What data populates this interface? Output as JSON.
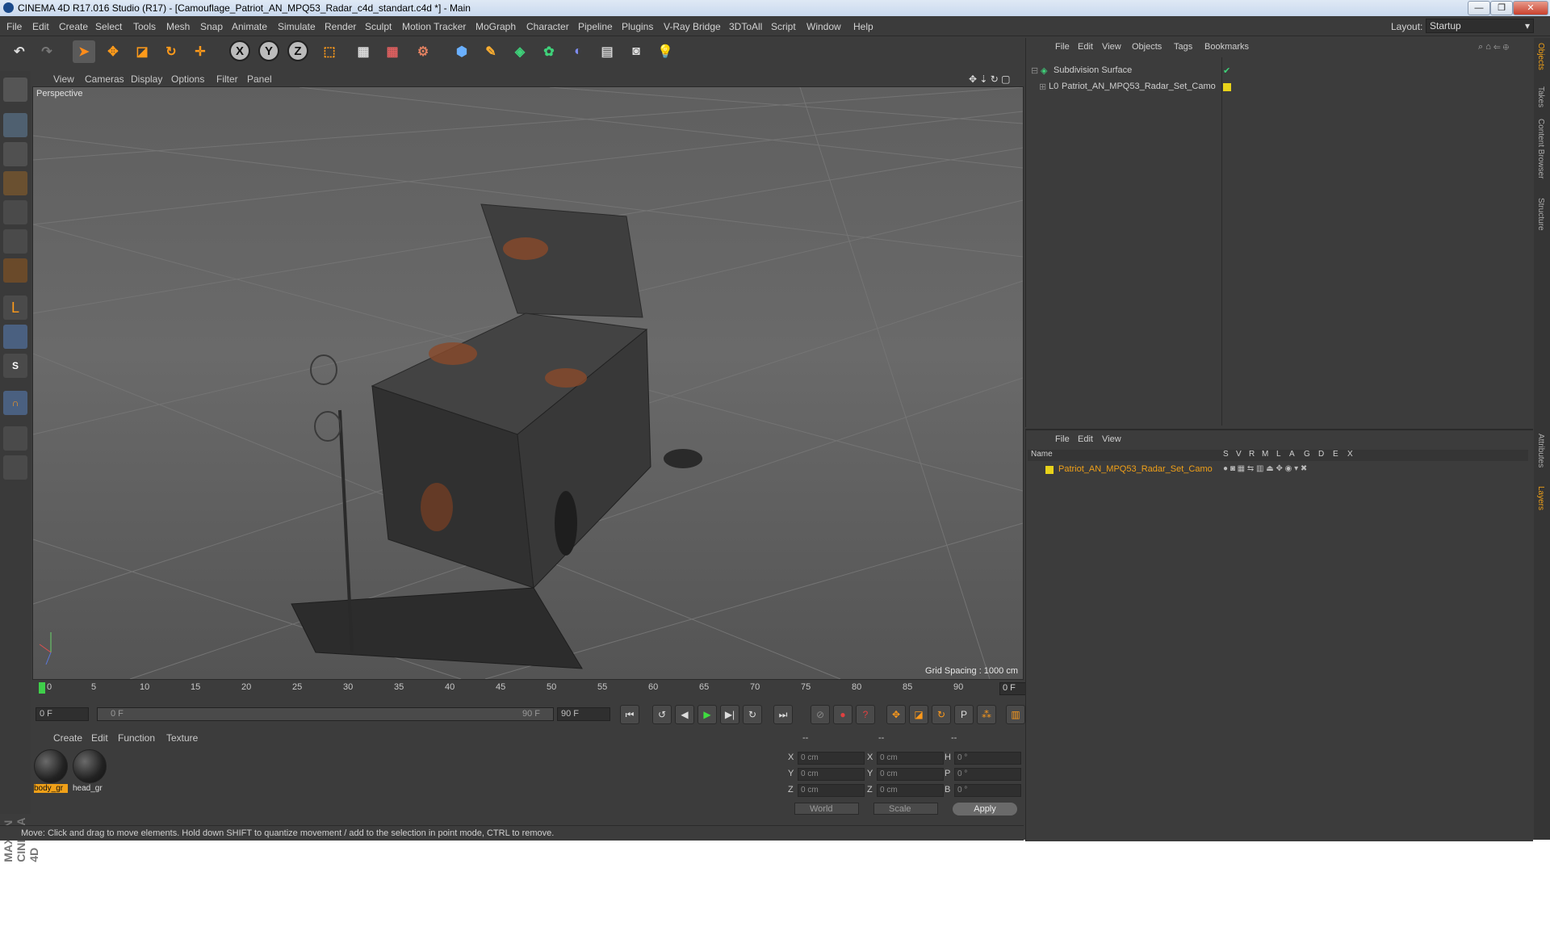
{
  "window": {
    "title": "CINEMA 4D R17.016 Studio (R17) - [Camouflage_Patriot_AN_MPQ53_Radar_c4d_standart.c4d *] - Main",
    "buttons": [
      "—",
      "❐",
      "✕"
    ]
  },
  "menubar": {
    "items": [
      "File",
      "Edit",
      "Create",
      "Select",
      "Tools",
      "Mesh",
      "Snap",
      "Animate",
      "Simulate",
      "Render",
      "Sculpt",
      "Motion Tracker",
      "MoGraph",
      "Character",
      "Pipeline",
      "Plugins",
      "V-Ray Bridge",
      "3DToAll",
      "Script",
      "Window",
      "Help"
    ],
    "layout_label": "Layout:",
    "layout_value": "Startup"
  },
  "toolbar": {
    "axis_x": "X",
    "axis_y": "Y",
    "axis_z": "Z"
  },
  "viewport": {
    "menu": [
      "View",
      "Cameras",
      "Display",
      "Options",
      "Filter",
      "Panel"
    ],
    "camera": "Perspective",
    "grid_spacing": "Grid Spacing : 1000 cm"
  },
  "timeline": {
    "ticks": [
      "0",
      "5",
      "10",
      "15",
      "20",
      "25",
      "30",
      "35",
      "40",
      "45",
      "50",
      "55",
      "60",
      "65",
      "70",
      "75",
      "80",
      "85",
      "90"
    ],
    "current_frame": "0 F",
    "start_field": "0 F",
    "range_start": "0 F",
    "range_end": "90 F",
    "end_field": "90 F"
  },
  "materials": {
    "menu": [
      "Create",
      "Edit",
      "Function",
      "Texture"
    ],
    "items": [
      {
        "label": "body_gr",
        "selected": true
      },
      {
        "label": "head_gr",
        "selected": false
      }
    ]
  },
  "coords": {
    "headers": [
      "--",
      "--",
      "--"
    ],
    "rows": [
      {
        "a": "X",
        "av": "0 cm",
        "b": "X",
        "bv": "0 cm",
        "c": "H",
        "cv": "0 °"
      },
      {
        "a": "Y",
        "av": "0 cm",
        "b": "Y",
        "bv": "0 cm",
        "c": "P",
        "cv": "0 °"
      },
      {
        "a": "Z",
        "av": "0 cm",
        "b": "Z",
        "bv": "0 cm",
        "c": "B",
        "cv": "0 °"
      }
    ],
    "world": "World",
    "scale": "Scale",
    "apply": "Apply"
  },
  "status": "Move: Click and drag to move elements. Hold down SHIFT to quantize movement / add to the selection in point mode, CTRL to remove.",
  "objects_panel": {
    "menu": [
      "File",
      "Edit",
      "View",
      "Objects",
      "Tags",
      "Bookmarks"
    ],
    "items": [
      {
        "name": "Subdivision Surface"
      },
      {
        "name": "Patriot_AN_MPQ53_Radar_Set_Camo"
      }
    ]
  },
  "layers_panel": {
    "menu": [
      "File",
      "Edit",
      "View"
    ],
    "header_name": "Name",
    "columns": [
      "S",
      "V",
      "R",
      "M",
      "L",
      "A",
      "G",
      "D",
      "E",
      "X"
    ],
    "items": [
      {
        "name": "Patriot_AN_MPQ53_Radar_Set_Camo"
      }
    ]
  },
  "side_tabs": [
    "Objects",
    "Takes",
    "Content Browser",
    "Structure",
    "Attributes",
    "Layers"
  ],
  "brand": "MAXON CINEMA 4D",
  "colors": {
    "accent": "#f0a018",
    "layer_yellow": "#e8d21a",
    "selected_text": "#f0a018"
  }
}
